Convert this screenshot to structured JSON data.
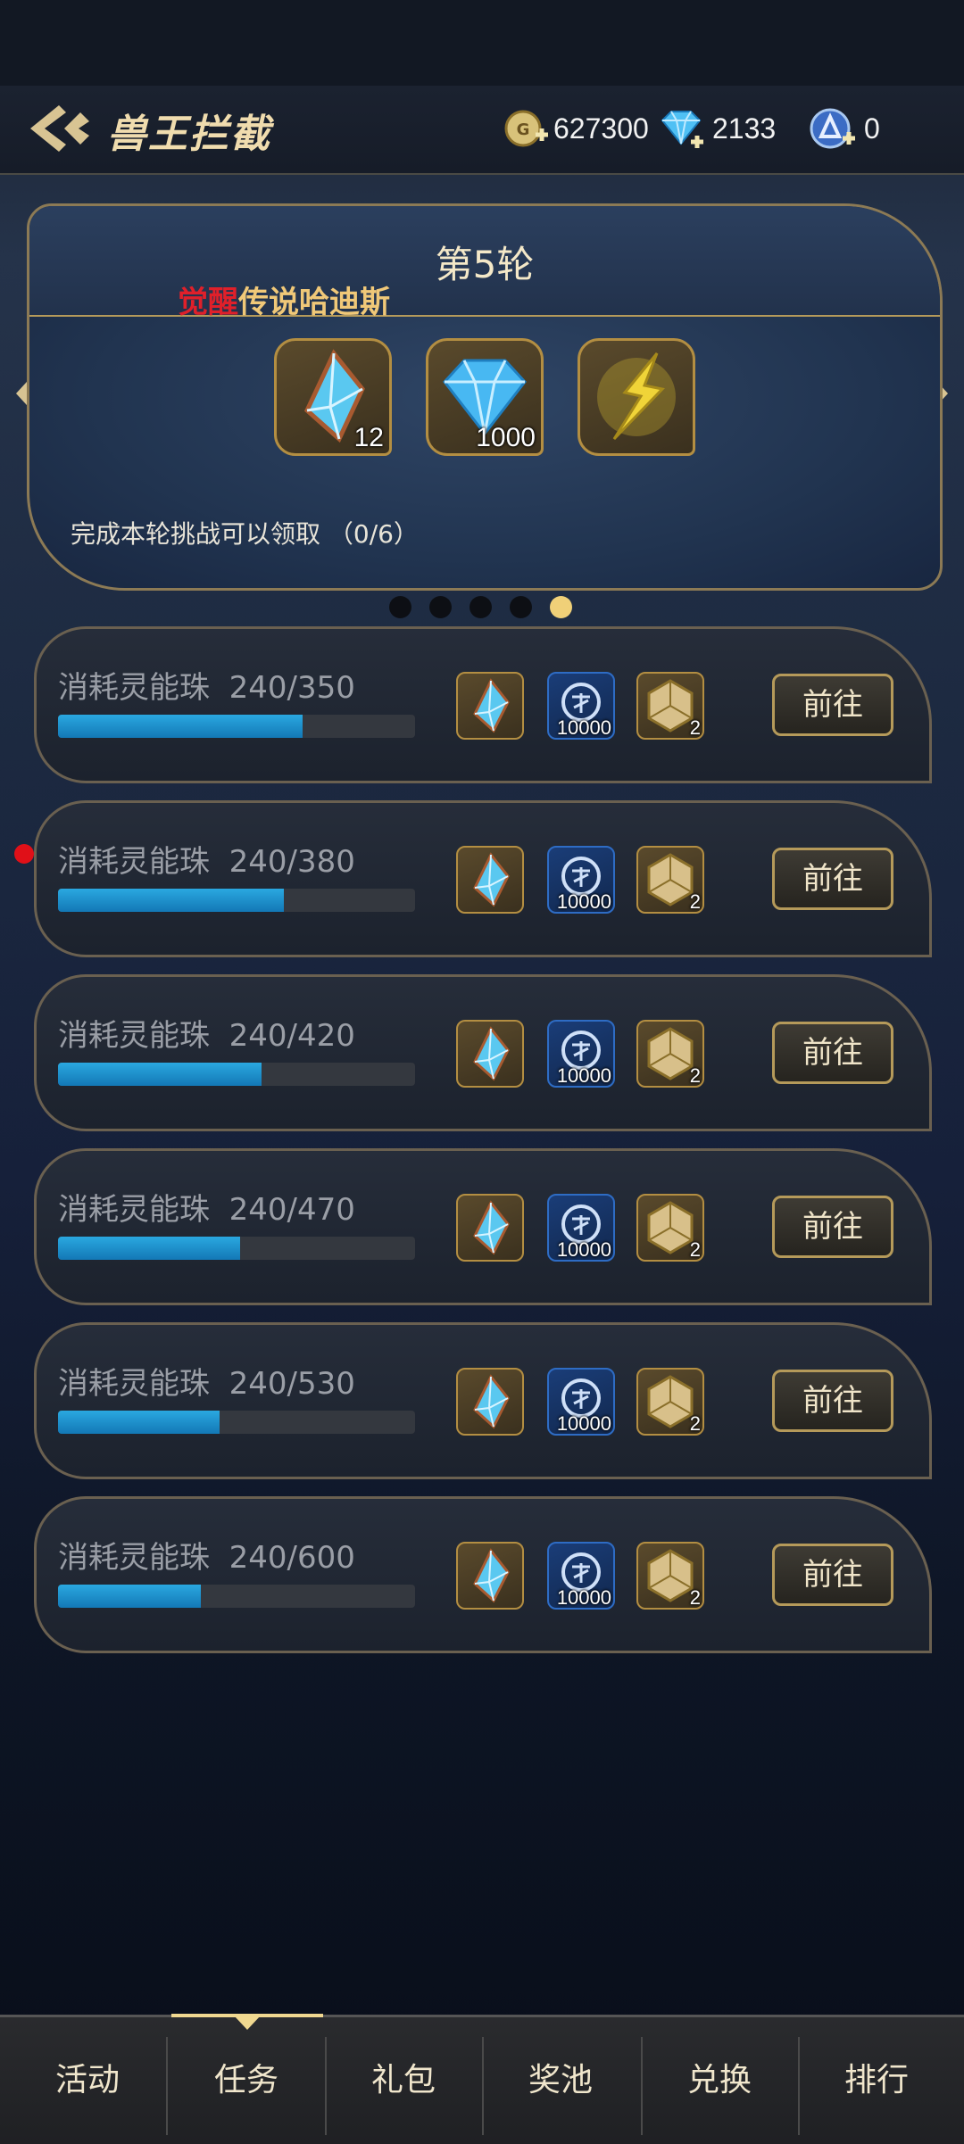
{
  "header": {
    "title": "兽王拦截",
    "gold": "627300",
    "diamond": "2133",
    "token": "0"
  },
  "round": {
    "title": "第5轮",
    "subtitle_red": "觉醒",
    "subtitle_rest": "传说哈迪斯",
    "rewards": [
      {
        "icon": "crystal-icon",
        "count": "12"
      },
      {
        "icon": "diamond-icon",
        "count": "1000"
      },
      {
        "icon": "gold-shard-icon",
        "count": ""
      }
    ],
    "note": "完成本轮挑战可以领取 （0/6）",
    "page_dots": 5,
    "active_dot": 5
  },
  "tasks": [
    {
      "label": "消耗灵能珠",
      "progress": "240/350",
      "fraction": 0.686,
      "coin": "10000",
      "die": "2",
      "button": "前往"
    },
    {
      "label": "消耗灵能珠",
      "progress": "240/380",
      "fraction": 0.632,
      "coin": "10000",
      "die": "2",
      "button": "前往"
    },
    {
      "label": "消耗灵能珠",
      "progress": "240/420",
      "fraction": 0.571,
      "coin": "10000",
      "die": "2",
      "button": "前往"
    },
    {
      "label": "消耗灵能珠",
      "progress": "240/470",
      "fraction": 0.511,
      "coin": "10000",
      "die": "2",
      "button": "前往"
    },
    {
      "label": "消耗灵能珠",
      "progress": "240/530",
      "fraction": 0.453,
      "coin": "10000",
      "die": "2",
      "button": "前往"
    },
    {
      "label": "消耗灵能珠",
      "progress": "240/600",
      "fraction": 0.4,
      "coin": "10000",
      "die": "2",
      "button": "前往"
    }
  ],
  "nav": {
    "tabs": [
      "活动",
      "任务",
      "礼包",
      "奖池",
      "兑换",
      "排行"
    ],
    "active": "任务"
  },
  "colors": {
    "accent_gold": "#f0d078",
    "progress_blue": "#2aa8e0",
    "badge_red": "#e01018"
  }
}
